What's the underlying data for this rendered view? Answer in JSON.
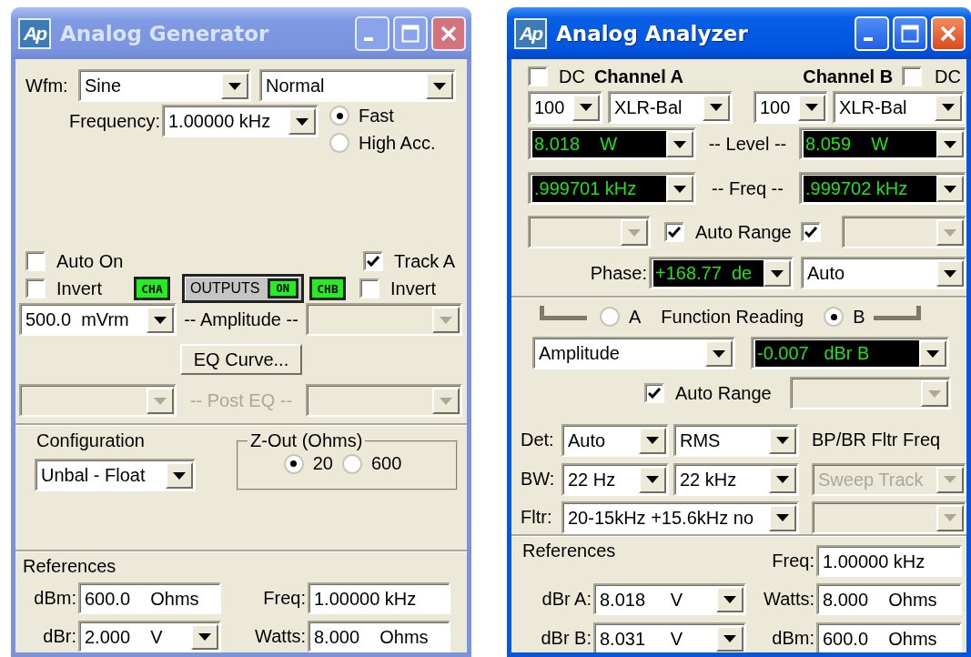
{
  "windows": [
    {
      "kind": "generator",
      "title": "Analog Generator",
      "logo": "Ap",
      "active": false,
      "waveform": {
        "label": "Wfm:",
        "shape": {
          "kind": "list",
          "value": "Sine"
        },
        "mode": {
          "kind": "list",
          "value": "Normal"
        }
      },
      "frequency": {
        "label": "Frequency:",
        "value": {
          "kind": "list",
          "value": "1.00000 kHz"
        },
        "accuracy": [
          {
            "label": "Fast",
            "selected": true
          },
          {
            "label": "High Acc.",
            "selected": false
          }
        ]
      },
      "auto_on": {
        "label": "Auto On",
        "checked": false
      },
      "track_a": {
        "label": "Track A",
        "checked": true
      },
      "invert_a": {
        "label": "Invert",
        "checked": false
      },
      "channel_a": {
        "label": "CHA",
        "on": true
      },
      "outputs": {
        "label": "OUTPUTS",
        "state": "ON",
        "on": true
      },
      "channel_b": {
        "label": "CHB",
        "on": true
      },
      "invert_b": {
        "label": "Invert",
        "checked": false
      },
      "amplitude": {
        "label": "-- Amplitude --",
        "a": {
          "kind": "list",
          "value": "500.0  mVrm"
        },
        "b": {
          "kind": "list",
          "disabled": true
        }
      },
      "eq_button": "EQ Curve...",
      "post_eq": {
        "label": "-- Post EQ --",
        "disabled": true,
        "a": {
          "kind": "list",
          "disabled": true
        },
        "b": {
          "kind": "list",
          "disabled": true
        }
      },
      "configuration": {
        "label": "Configuration",
        "value": {
          "kind": "list",
          "value": "Unbal - Float"
        }
      },
      "z_out": {
        "label": "Z-Out (Ohms)",
        "options": [
          {
            "label": "20",
            "selected": true
          },
          {
            "label": "600",
            "selected": false
          }
        ]
      },
      "references": {
        "label": "References",
        "rows": [
          [
            {
              "label": "dBm:",
              "value": {
                "kind": "text",
                "value": "600.0    Ohms"
              }
            },
            {
              "label": "Freq:",
              "value": {
                "kind": "text",
                "value": "1.00000 kHz"
              }
            }
          ],
          [
            {
              "label": "dBr:",
              "value": {
                "kind": "list",
                "value": "2.000    V"
              }
            },
            {
              "label": "Watts:",
              "value": {
                "kind": "text",
                "value": "8.000    Ohms"
              }
            }
          ]
        ]
      }
    },
    {
      "kind": "analyzer",
      "title": "Analog Analyzer",
      "logo": "Ap",
      "active": true,
      "channels": [
        {
          "name": "Channel A",
          "dc": {
            "label": "DC",
            "checked": false
          },
          "range": {
            "kind": "list",
            "value": "100"
          },
          "input": {
            "kind": "list",
            "value": "XLR-Bal"
          },
          "level": {
            "kind": "readout",
            "value": "8.018    W"
          },
          "freq": {
            "kind": "readout",
            "value": ".999701 kHz"
          },
          "auto_range": {
            "checked": true
          },
          "range_select": {
            "kind": "list",
            "disabled": true
          }
        },
        {
          "name": "Channel B",
          "dc": {
            "label": "DC",
            "checked": false
          },
          "range": {
            "kind": "list",
            "value": "100"
          },
          "input": {
            "kind": "list",
            "value": "XLR-Bal"
          },
          "level": {
            "kind": "readout",
            "value": "8.059    W"
          },
          "freq": {
            "kind": "readout",
            "value": ".999702 kHz"
          },
          "auto_range": {
            "checked": true
          },
          "range_select": {
            "kind": "list",
            "disabled": true
          }
        }
      ],
      "level_label": "-- Level --",
      "freq_label": "-- Freq --",
      "auto_range_label": "Auto Range",
      "phase": {
        "label": "Phase:",
        "value": {
          "kind": "readout",
          "value": "+168.77  de"
        },
        "mode": {
          "kind": "list",
          "value": "Auto"
        }
      },
      "function_reading": {
        "label": "Function Reading",
        "channels": [
          {
            "label": "A",
            "selected": false
          },
          {
            "label": "B",
            "selected": true
          }
        ],
        "function": {
          "kind": "list",
          "value": "Amplitude"
        },
        "reading": {
          "kind": "readout",
          "value": "-0.007   dBr B"
        },
        "auto_range": {
          "label": "Auto Range",
          "checked": true
        },
        "range": {
          "kind": "list",
          "disabled": true
        }
      },
      "detector": {
        "label": "Det:",
        "type": {
          "kind": "list",
          "value": "Auto"
        },
        "mode": {
          "kind": "list",
          "value": "RMS"
        }
      },
      "bandwidth": {
        "label": "BW:",
        "low": {
          "kind": "list",
          "value": "22 Hz"
        },
        "high": {
          "kind": "list",
          "value": "22 kHz"
        }
      },
      "filter": {
        "label": "Fltr:",
        "value": {
          "kind": "list",
          "value": "20-15kHz +15.6kHz no"
        }
      },
      "bp_br": {
        "label": "BP/BR Fltr Freq",
        "value": {
          "kind": "list",
          "value": "Sweep Track",
          "disabled": true
        },
        "extra": {
          "kind": "list",
          "disabled": true
        }
      },
      "references": {
        "label": "References",
        "rows": [
          [
            null,
            {
              "label": "Freq:",
              "value": {
                "kind": "text",
                "value": "1.00000 kHz"
              }
            }
          ],
          [
            {
              "label": "dBr A:",
              "value": {
                "kind": "list",
                "value": "8.018     V"
              }
            },
            {
              "label": "Watts:",
              "value": {
                "kind": "text",
                "value": "8.000    Ohms"
              }
            }
          ],
          [
            {
              "label": "dBr B:",
              "value": {
                "kind": "list",
                "value": "8.031     V"
              }
            },
            {
              "label": "dBm:",
              "value": {
                "kind": "text",
                "value": "600.0    Ohms"
              }
            }
          ]
        ]
      }
    }
  ]
}
